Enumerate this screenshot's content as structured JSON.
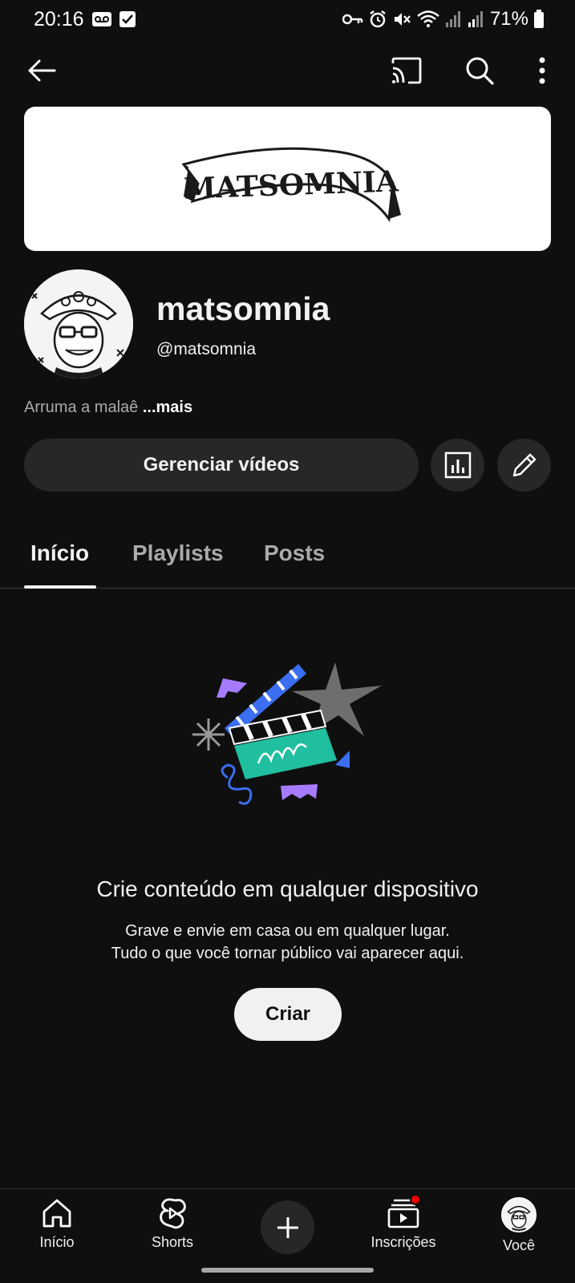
{
  "status_bar": {
    "time": "20:16",
    "battery": "71%",
    "icons": [
      "voicemail-icon",
      "check-box-icon",
      "vpn-key-icon",
      "alarm-icon",
      "mute-icon",
      "wifi-icon",
      "signal-icon",
      "signal-icon",
      "battery-icon"
    ]
  },
  "top_bar": {
    "icons": [
      "back-arrow-icon",
      "cast-icon",
      "search-icon",
      "more-vert-icon"
    ]
  },
  "banner": {
    "logo_text": "MATSOMNIA"
  },
  "channel": {
    "name": "matsomnia",
    "handle": "@matsomnia",
    "description": "Arruma a malaê",
    "more_label": "...mais"
  },
  "actions": {
    "manage_label": "Gerenciar vídeos",
    "analytics_icon": "analytics-icon",
    "edit_icon": "pencil-icon"
  },
  "tabs": [
    {
      "label": "Início",
      "active": true
    },
    {
      "label": "Playlists",
      "active": false
    },
    {
      "label": "Posts",
      "active": false
    }
  ],
  "empty_state": {
    "title": "Crie conteúdo em qualquer dispositivo",
    "line1": "Grave e envie em casa ou em qualquer lugar.",
    "line2": "Tudo o que você tornar público vai aparecer aqui.",
    "button": "Criar"
  },
  "bottom_nav": {
    "items": [
      {
        "label": "Início",
        "icon": "home-icon"
      },
      {
        "label": "Shorts",
        "icon": "shorts-icon"
      },
      {
        "label": "",
        "icon": "plus-icon"
      },
      {
        "label": "Inscrições",
        "icon": "subscriptions-icon"
      },
      {
        "label": "Você",
        "icon": "avatar"
      }
    ]
  },
  "colors": {
    "background": "#0f0f0f",
    "surface": "#272727",
    "text": "#f1f1f1",
    "secondary_text": "#aaaaaa",
    "notification": "#ee0000",
    "illustration_teal": "#1fbf9f",
    "illustration_blue": "#3b6ef0",
    "illustration_purple": "#a77bff"
  }
}
